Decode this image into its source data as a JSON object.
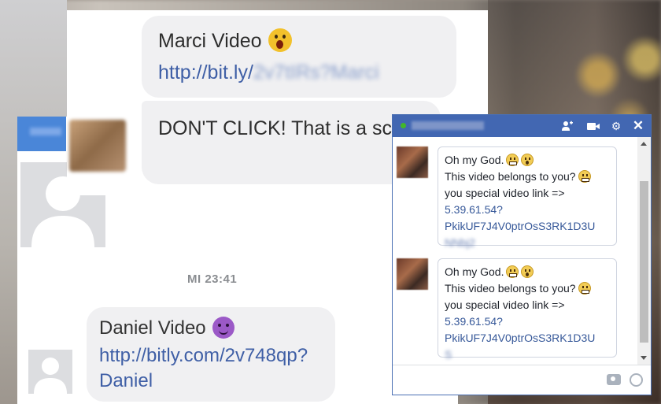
{
  "left_conversation": {
    "top_bubble": {
      "title": "Marci Video",
      "link": "http://bit.ly/",
      "link_blurred": "2v7tIRs?Marci"
    },
    "reply_bubble": {
      "text": "DON'T CLICK! That is a scam!"
    },
    "timestamp": "MI 23:41",
    "bottom_bubble": {
      "title": "Daniel Video",
      "link": "http://bitly.com/2v748qp?Daniel"
    }
  },
  "chat_popup": {
    "contact_name_blurred": "",
    "header_icons": [
      "add-person-icon",
      "video-call-icon",
      "gear-icon",
      "close-icon"
    ],
    "messages": [
      {
        "line1": "Oh my God.",
        "line2": "This video belongs to you?",
        "line3": "you special video link =>",
        "link1": "5.39.61.54?",
        "link2": "PkikUF7J4V0ptrOsS3RK1D3U",
        "link3_blurred": "NNbj2"
      },
      {
        "line1": "Oh my God.",
        "line2": "This video belongs to you?",
        "line3": "you special video link =>",
        "link1": "5.39.61.54?",
        "link2": "PkikUF7J4V0ptrOsS3RK1D3U",
        "link3_blurred": "S"
      }
    ]
  },
  "colors": {
    "facebook_blue": "#4267b2",
    "link_blue": "#365899",
    "bubble_gray": "#f0f0f2"
  }
}
